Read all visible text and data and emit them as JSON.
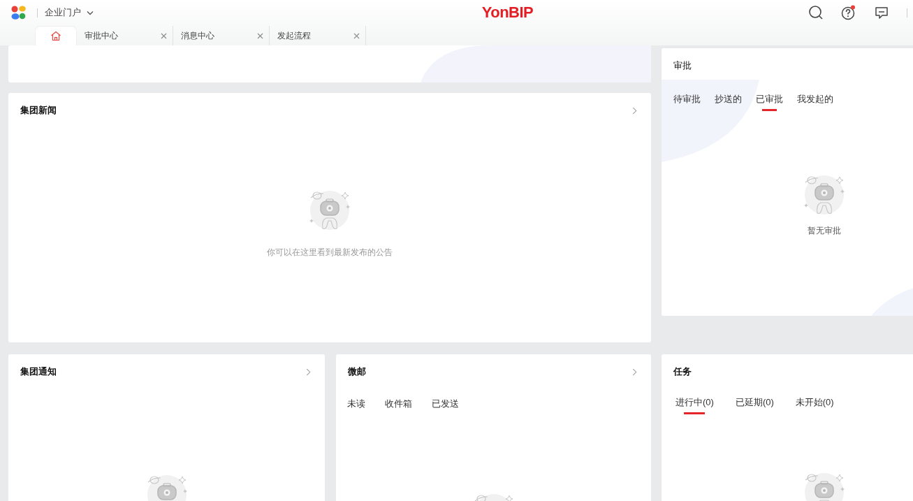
{
  "header": {
    "portal": "企业门户",
    "brand": "YonBIP",
    "help_badge": true
  },
  "tabs": [
    {
      "kind": "home",
      "selected": true
    },
    {
      "kind": "page",
      "label": "审批中心",
      "selected": false
    },
    {
      "kind": "page",
      "label": "消息中心",
      "selected": false
    },
    {
      "kind": "page",
      "label": "发起流程",
      "selected": false
    }
  ],
  "news": {
    "title": "集团新闻",
    "more": true,
    "empty_text": "你可以在这里看到最新发布的公告"
  },
  "approval": {
    "title": "审批",
    "tabs": [
      {
        "label": "待审批",
        "selected": false
      },
      {
        "label": "抄送的",
        "selected": false
      },
      {
        "label": "已审批",
        "selected": true
      },
      {
        "label": "我发起的",
        "selected": false
      }
    ],
    "empty_text": "暂无审批"
  },
  "notice": {
    "title": "集团通知",
    "more": true
  },
  "mail": {
    "title": "微邮",
    "more": true,
    "tabs": [
      {
        "label": "未读",
        "selected": false
      },
      {
        "label": "收件箱",
        "selected": false
      },
      {
        "label": "已发送",
        "selected": false
      }
    ]
  },
  "tasks": {
    "title": "任务",
    "tabs": [
      {
        "label": "进行中(0)",
        "selected": true
      },
      {
        "label": "已延期(0)",
        "selected": false
      },
      {
        "label": "未开始(0)",
        "selected": false
      }
    ]
  }
}
